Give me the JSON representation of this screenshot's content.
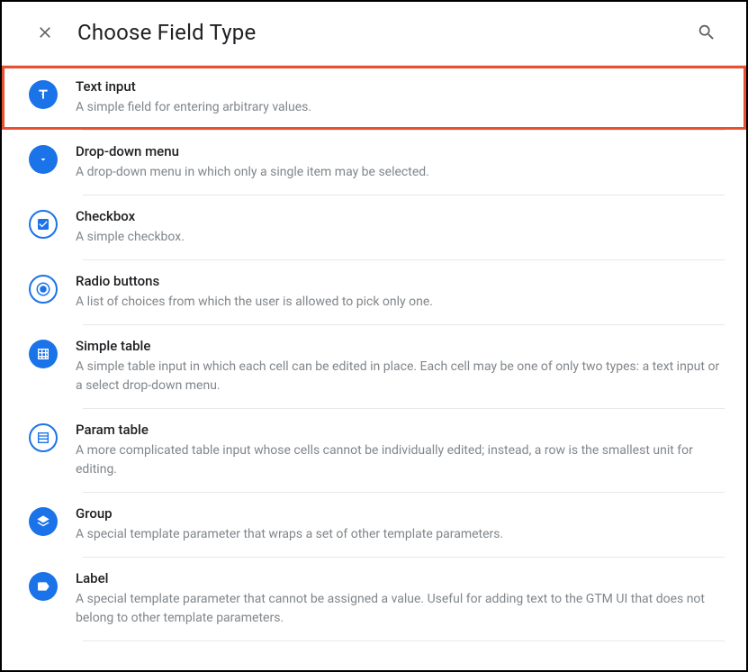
{
  "header": {
    "title": "Choose Field Type"
  },
  "items": [
    {
      "title": "Text input",
      "description": "A simple field for entering arbitrary values."
    },
    {
      "title": "Drop-down menu",
      "description": "A drop-down menu in which only a single item may be selected."
    },
    {
      "title": "Checkbox",
      "description": "A simple checkbox."
    },
    {
      "title": "Radio buttons",
      "description": "A list of choices from which the user is allowed to pick only one."
    },
    {
      "title": "Simple table",
      "description": "A simple table input in which each cell can be edited in place. Each cell may be one of only two types: a text input or a select drop-down menu."
    },
    {
      "title": "Param table",
      "description": "A more complicated table input whose cells cannot be individually edited; instead, a row is the smallest unit for editing."
    },
    {
      "title": "Group",
      "description": "A special template parameter that wraps a set of other template parameters."
    },
    {
      "title": "Label",
      "description": "A special template parameter that cannot be assigned a value. Useful for adding text to the GTM UI that does not belong to other template parameters."
    }
  ]
}
